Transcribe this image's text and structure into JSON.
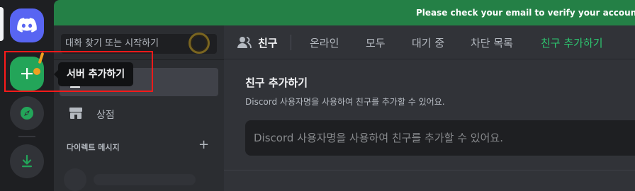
{
  "banner": {
    "text": "Please check your email to verify your account"
  },
  "rail": {
    "home_icon": "discord-logo-icon",
    "add_server_icon": "plus-icon",
    "discover_icon": "compass-icon",
    "download_icon": "download-icon"
  },
  "sidebar": {
    "search_placeholder": "대화 찾기 또는 시작하기",
    "shop_label": "상점",
    "dm_header": "다이렉트 메시지",
    "dm_add": "+"
  },
  "topbar": {
    "title": "친구",
    "tabs": [
      "온라인",
      "모두",
      "대기 중",
      "차단 목록",
      "친구 추가하기"
    ]
  },
  "add_friend": {
    "title": "친구 추가하기",
    "description": "Discord 사용자명을 사용하여 친구를 추가할 수 있어요.",
    "input_placeholder": "Discord 사용자명을 사용하여 친구를 추가할 수 있어요."
  },
  "tooltip": {
    "text": "서버 추가하기"
  },
  "colors": {
    "blurple": "#5865f2",
    "green": "#23a559",
    "banner": "#248046",
    "highlight": "#ff1a1a"
  }
}
